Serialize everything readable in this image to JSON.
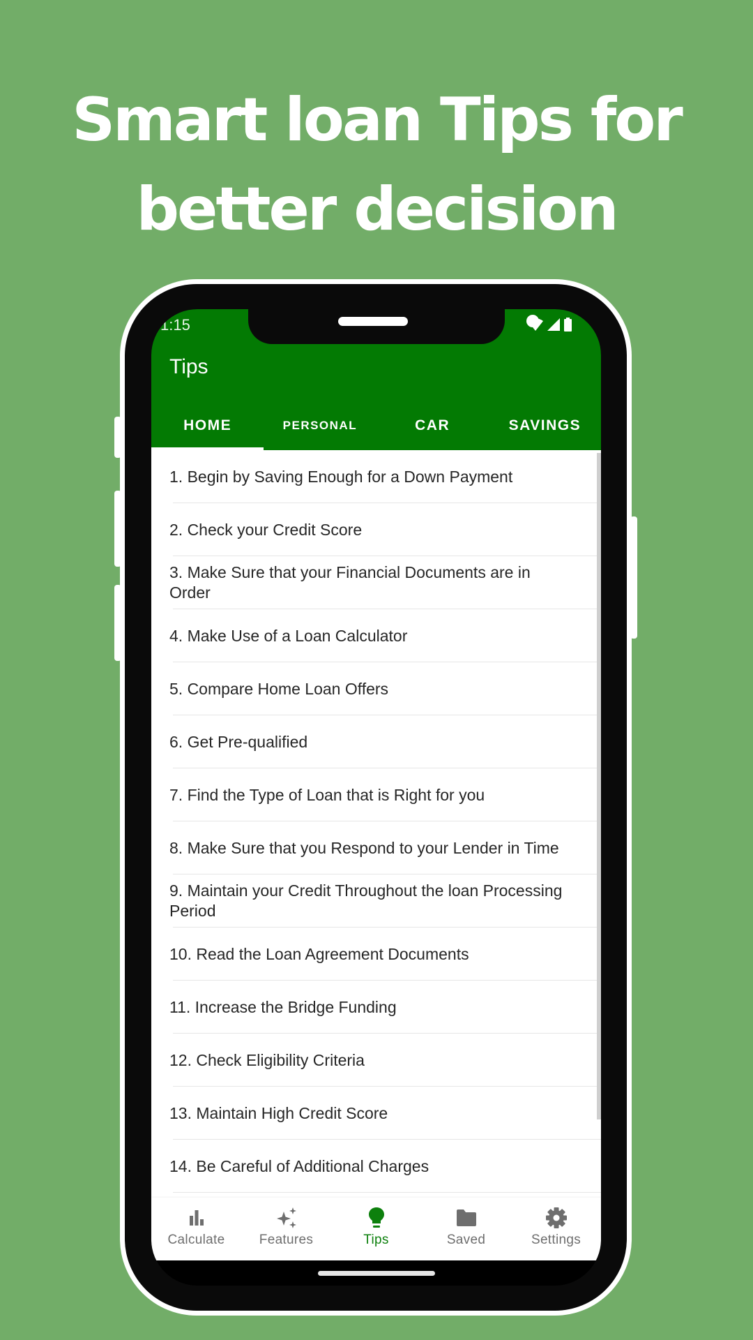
{
  "headline": {
    "line1": "Smart loan Tips for",
    "line2": "better decision"
  },
  "colors": {
    "background": "#72ad68",
    "appbar": "#037a03",
    "accent_active": "#0d800d",
    "inactive": "#6e6e6e"
  },
  "status_bar": {
    "time": "1:15",
    "icons": [
      "wifi-icon",
      "signal-icon",
      "battery-icon"
    ]
  },
  "app_bar": {
    "title": "Tips"
  },
  "tabs": [
    {
      "label": "HOME",
      "active": true
    },
    {
      "label": "PERSONAL",
      "active": false
    },
    {
      "label": "CAR",
      "active": false
    },
    {
      "label": "SAVINGS",
      "active": false
    }
  ],
  "tips": [
    "1. Begin by Saving Enough for a Down Payment",
    "2. Check your Credit Score",
    "3. Make Sure that your Financial Documents are in Order",
    "4. Make Use of a Loan Calculator",
    "5. Compare Home Loan Offers",
    "6. Get Pre-qualified",
    "7. Find the Type of Loan that is Right for you",
    "8. Make Sure that you Respond to your Lender in Time",
    "9. Maintain your Credit Throughout the loan Processing Period",
    "10. Read the Loan Agreement Documents",
    "11. Increase the Bridge Funding",
    "12. Check Eligibility Criteria",
    "13. Maintain High Credit Score",
    "14. Be Careful of Additional Charges"
  ],
  "bottom_nav": [
    {
      "label": "Calculate",
      "icon": "bar-chart-icon",
      "active": false
    },
    {
      "label": "Features",
      "icon": "sparkles-icon",
      "active": false
    },
    {
      "label": "Tips",
      "icon": "lightbulb-icon",
      "active": true
    },
    {
      "label": "Saved",
      "icon": "folder-icon",
      "active": false
    },
    {
      "label": "Settings",
      "icon": "gear-icon",
      "active": false
    }
  ]
}
